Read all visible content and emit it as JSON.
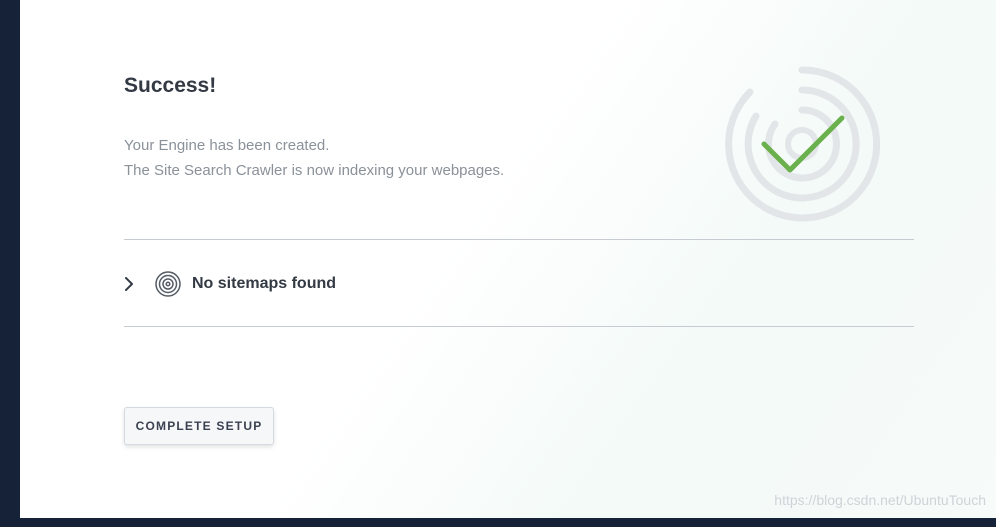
{
  "success": {
    "title": "Success!",
    "line1": "Your Engine has been created.",
    "line2": "The Site Search Crawler is now indexing your webpages."
  },
  "sitemaps": {
    "label": "No sitemaps found",
    "expanded": false
  },
  "cta": {
    "label": "COMPLETE SETUP"
  },
  "watermark": "https://blog.csdn.net/UbuntuTouch",
  "colors": {
    "check": "#6ab04c",
    "rings": "#e3e6e8",
    "text_dark": "#333a44",
    "text_muted": "#8a9199",
    "sidebar": "#152238"
  }
}
